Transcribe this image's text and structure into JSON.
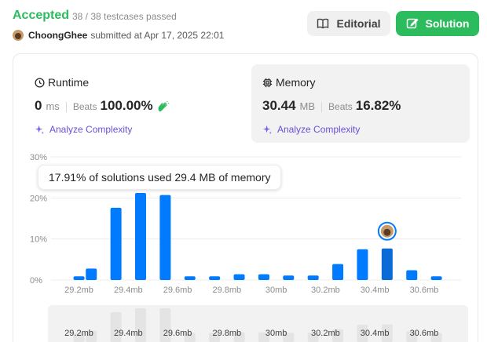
{
  "header": {
    "status": "Accepted",
    "testcases": "38 / 38 testcases passed",
    "username": "ChoongGhee",
    "submitted_at": "submitted at Apr 17, 2025 22:01",
    "editorial_label": "Editorial",
    "solution_label": "Solution"
  },
  "runtime": {
    "title": "Runtime",
    "value": "0",
    "unit": "ms",
    "beats_label": "Beats",
    "beats_value": "100.00%",
    "analyze_label": "Analyze Complexity"
  },
  "memory": {
    "title": "Memory",
    "value": "30.44",
    "unit": "MB",
    "beats_label": "Beats",
    "beats_value": "16.82%",
    "analyze_label": "Analyze Complexity"
  },
  "tooltip": "17.91% of solutions used 29.4 MB of memory",
  "colors": {
    "accent_green": "#2cbb5d",
    "bar_blue": "#007aff",
    "bar_highlight": "#0a6bd6",
    "analyze_purple": "#6b4fd8"
  },
  "chart_data": {
    "type": "bar",
    "xlabel": "",
    "ylabel": "",
    "ylim": [
      0,
      30
    ],
    "y_ticks": [
      "0%",
      "10%",
      "20%",
      "30%"
    ],
    "x_tick_labels": [
      "29.2mb",
      "29.4mb",
      "29.6mb",
      "29.8mb",
      "30mb",
      "30.2mb",
      "30.4mb",
      "30.6mb"
    ],
    "categories": [
      "29.2",
      "29.25",
      "29.3",
      "29.35",
      "29.4",
      "29.45",
      "29.5",
      "29.55",
      "29.6",
      "29.65",
      "29.7",
      "29.75",
      "29.8",
      "29.85",
      "29.9",
      "29.95",
      "30.0",
      "30.05",
      "30.1"
    ],
    "x": [
      29.2,
      29.25,
      29.35,
      29.45,
      29.55,
      29.65,
      29.75,
      29.85,
      29.95,
      30.05,
      30.15,
      30.25,
      30.35,
      30.45,
      30.55,
      30.65
    ],
    "values": [
      0.9,
      2.8,
      17.6,
      21.2,
      20.7,
      0.9,
      0.9,
      1.4,
      1.4,
      1.1,
      1.1,
      3.9,
      7.5,
      7.7,
      2.4,
      0.9
    ],
    "highlight_x": 30.45,
    "grid": true,
    "navigator_labels": [
      "29.2mb",
      "29.4mb",
      "29.6mb",
      "29.8mb",
      "30mb",
      "30.2mb",
      "30.4mb",
      "30.6mb"
    ]
  }
}
